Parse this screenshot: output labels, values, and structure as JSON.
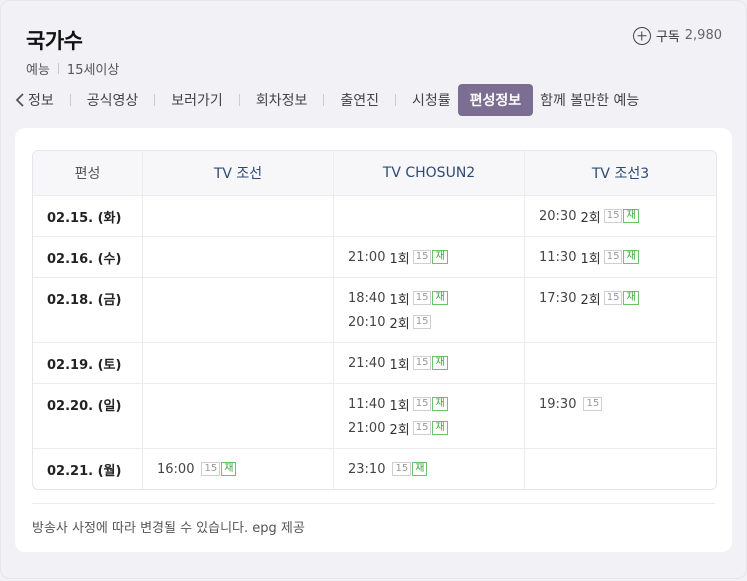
{
  "header": {
    "title": "국가수",
    "genre": "예능",
    "rating": "15세이상",
    "subscribe_label": "구독",
    "subscribe_count": "2,980"
  },
  "tabs": [
    {
      "label": "정보",
      "active": false
    },
    {
      "label": "공식영상",
      "active": false
    },
    {
      "label": "보러가기",
      "active": false
    },
    {
      "label": "회차정보",
      "active": false
    },
    {
      "label": "출연진",
      "active": false
    },
    {
      "label": "시청률",
      "active": false
    },
    {
      "label": "편성정보",
      "active": true
    },
    {
      "label": "함께 볼만한 예능",
      "active": false
    }
  ],
  "schedule": {
    "headers": [
      "편성",
      "TV 조선",
      "TV CHOSUN2",
      "TV 조선3"
    ],
    "rows": [
      {
        "date": "02.15. (화)",
        "ch1": [],
        "ch2": [],
        "ch3": [
          {
            "time": "20:30",
            "ep": "2회",
            "rating": "15",
            "re": "재"
          }
        ]
      },
      {
        "date": "02.16. (수)",
        "ch1": [],
        "ch2": [
          {
            "time": "21:00",
            "ep": "1회",
            "rating": "15",
            "re": "재"
          }
        ],
        "ch3": [
          {
            "time": "11:30",
            "ep": "1회",
            "rating": "15",
            "re": "재"
          }
        ]
      },
      {
        "date": "02.18. (금)",
        "ch1": [],
        "ch2": [
          {
            "time": "18:40",
            "ep": "1회",
            "rating": "15",
            "re": "재"
          },
          {
            "time": "20:10",
            "ep": "2회",
            "rating": "15",
            "re": ""
          }
        ],
        "ch3": [
          {
            "time": "17:30",
            "ep": "2회",
            "rating": "15",
            "re": "재"
          }
        ]
      },
      {
        "date": "02.19. (토)",
        "ch1": [],
        "ch2": [
          {
            "time": "21:40",
            "ep": "1회",
            "rating": "15",
            "re": "재"
          }
        ],
        "ch3": []
      },
      {
        "date": "02.20. (일)",
        "ch1": [],
        "ch2": [
          {
            "time": "11:40",
            "ep": "1회",
            "rating": "15",
            "re": "재"
          },
          {
            "time": "21:00",
            "ep": "2회",
            "rating": "15",
            "re": "재"
          }
        ],
        "ch3": [
          {
            "time": "19:30",
            "ep": "",
            "rating": "15",
            "re": ""
          }
        ]
      },
      {
        "date": "02.21. (월)",
        "ch1": [
          {
            "time": "16:00",
            "ep": "",
            "rating": "15",
            "re": "재"
          }
        ],
        "ch2": [
          {
            "time": "23:10",
            "ep": "",
            "rating": "15",
            "re": "재"
          }
        ],
        "ch3": []
      }
    ]
  },
  "notice": "방송사 사정에 따라 변경될 수 있습니다. epg 제공",
  "colors": {
    "active_tab": "#7b6e92",
    "channel_header": "#2d4a75",
    "rerun_badge": "#3aa83a"
  },
  "icons": {
    "prev": "chevron-left-icon",
    "subscribe": "plus-circle-icon"
  }
}
